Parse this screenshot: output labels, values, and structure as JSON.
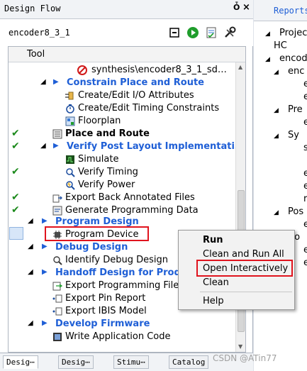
{
  "left_panel": {
    "title": "Design Flow",
    "pin_glyph": "Ȱ",
    "close_glyph": "×",
    "project": "encoder8_3_1",
    "column_header": "Tool",
    "tree": [
      {
        "label": "synthesis\\encoder8_3_1_sd…",
        "icon": "error-icon"
      },
      {
        "label": "Constrain Place and Route",
        "icon": "none"
      },
      {
        "label": "Create/Edit I/O Attributes",
        "icon": "io-attributes-icon"
      },
      {
        "label": "Create/Edit Timing Constraints",
        "icon": "timing-constraints-icon"
      },
      {
        "label": "Floorplan",
        "icon": "floorplan-icon"
      },
      {
        "label": "Place and Route",
        "icon": "place-route-icon",
        "status": "check"
      },
      {
        "label": "Verify Post Layout Implementati…",
        "icon": "none",
        "status": "check-warning"
      },
      {
        "label": "Simulate",
        "icon": "simulate-icon"
      },
      {
        "label": "Verify Timing",
        "icon": "verify-timing-icon",
        "status": "check-warning"
      },
      {
        "label": "Verify Power",
        "icon": "verify-power-icon"
      },
      {
        "label": "Export Back Annotated Files",
        "icon": "export-icon",
        "status": "check"
      },
      {
        "label": "Generate Programming Data",
        "icon": "generate-icon",
        "status": "check"
      },
      {
        "label": "Program Design",
        "icon": "none"
      },
      {
        "label": "Program Device",
        "icon": "program-device-icon"
      },
      {
        "label": "Debug Design",
        "icon": "none"
      },
      {
        "label": "Identify Debug Design",
        "icon": "identify-icon"
      },
      {
        "label": "Handoff Design for Produ",
        "icon": "none"
      },
      {
        "label": "Export Programming File",
        "icon": "export-file-icon"
      },
      {
        "label": "Export Pin Report",
        "icon": "pin-report-icon"
      },
      {
        "label": "Export IBIS Model",
        "icon": "ibis-icon"
      },
      {
        "label": "Develop Firmware",
        "icon": "none"
      },
      {
        "label": "Write Application Code",
        "icon": "app-code-icon"
      }
    ],
    "bottom_tabs": [
      "Desig⋯",
      "Desig⋯",
      "Stimu⋯",
      "Catalog"
    ],
    "watermark": "CSDN @ATin77"
  },
  "right_panel": {
    "tab": "Reports",
    "items": [
      "Projec",
      "HC",
      "encod",
      "enc",
      "e",
      "e",
      "Pre",
      "e",
      "Sy",
      "s",
      "e",
      "e",
      "r",
      "Pos",
      "e",
      "Co",
      "e",
      "e"
    ]
  },
  "context_menu": {
    "items": [
      "Run",
      "Clean and Run All",
      "Open Interactively",
      "Clean",
      "Help"
    ]
  },
  "colors": {
    "section_blue": "#1f5fd6",
    "check_green": "#1c8a1c",
    "highlight_red": "#e0141e",
    "selection": "#d7e6f8"
  }
}
